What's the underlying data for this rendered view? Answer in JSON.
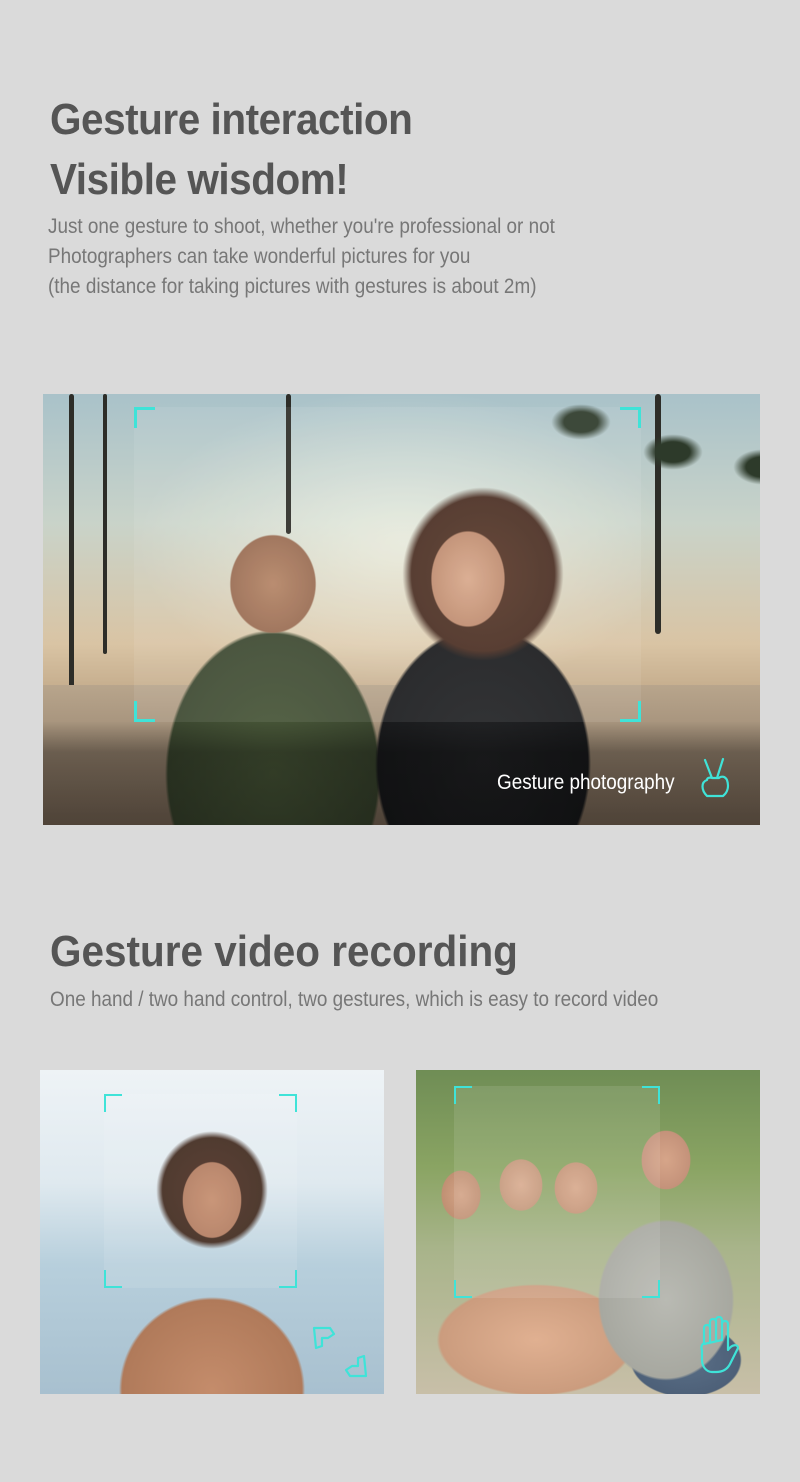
{
  "section1": {
    "title_line1": "Gesture interaction",
    "title_line2": "Visible wisdom!",
    "desc_line1": "Just one gesture to shoot, whether you're professional or not",
    "desc_line2": "Photographers can take wonderful pictures for you",
    "desc_line3": "(the distance for taking pictures with gestures is about 2m)",
    "photo_caption": "Gesture photography",
    "caption_icon": "victory-hand-icon"
  },
  "section2": {
    "title": "Gesture video recording",
    "desc": "One hand / two hand control, two gestures, which is easy to record video",
    "left_icon": "frame-hands-icon",
    "right_icon": "open-palm-icon"
  },
  "colors": {
    "background": "#dadada",
    "heading": "#555555",
    "body_text": "#777777",
    "accent_cyan": "#3fe3d8",
    "caption_text": "#ffffff"
  }
}
